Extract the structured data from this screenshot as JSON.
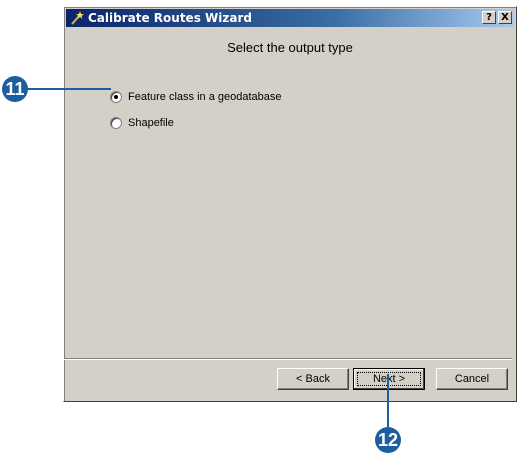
{
  "window": {
    "title": "Calibrate Routes Wizard",
    "help_label": "?",
    "close_label": "X"
  },
  "page": {
    "heading": "Select the output type"
  },
  "options": [
    {
      "label": "Feature class in a geodatabase",
      "selected": true
    },
    {
      "label": "Shapefile",
      "selected": false
    }
  ],
  "buttons": {
    "back": "< Back",
    "next": "Next >",
    "cancel": "Cancel"
  },
  "callouts": {
    "step_11": "11",
    "step_12": "12"
  },
  "colors": {
    "callout": "#1d5f9e",
    "titlebar_start": "#0a246a",
    "titlebar_end": "#a6caf0",
    "dialog_face": "#d4d0c8"
  },
  "icons": {
    "app": "wizard-wand-icon"
  }
}
